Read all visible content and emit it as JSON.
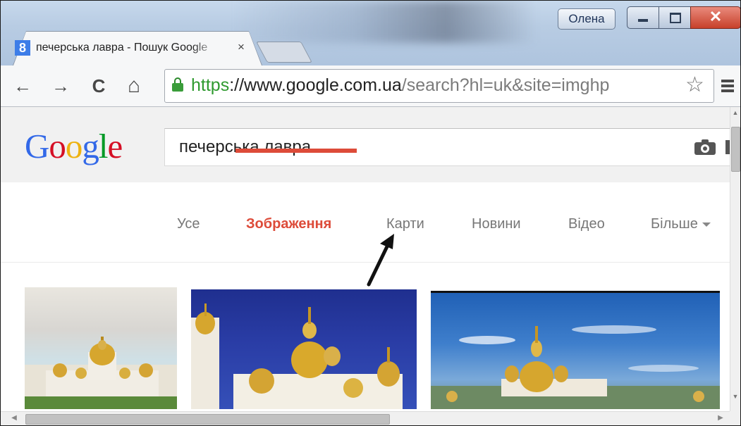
{
  "window": {
    "profile_name": "Олена"
  },
  "tab": {
    "favicon_letter": "8",
    "title": "печерська лавра - Пошук Google"
  },
  "toolbar": {
    "back_glyph": "←",
    "forward_glyph": "→",
    "reload_glyph": "C",
    "home_glyph": "⌂",
    "url_scheme": "https",
    "url_sep": "://",
    "url_host": "www.google.com.ua",
    "url_path": "/search?hl=uk&site=imghp",
    "star_glyph": "☆"
  },
  "google": {
    "logo_letters": [
      {
        "ch": "G",
        "color": "#3369e8"
      },
      {
        "ch": "o",
        "color": "#d50f25"
      },
      {
        "ch": "o",
        "color": "#eeb211"
      },
      {
        "ch": "g",
        "color": "#3369e8"
      },
      {
        "ch": "l",
        "color": "#009925"
      },
      {
        "ch": "e",
        "color": "#d50f25"
      }
    ],
    "query": "печерська лавра",
    "tabs": [
      {
        "label": "Усе",
        "active": false
      },
      {
        "label": "Зображення",
        "active": true
      },
      {
        "label": "Карти",
        "active": false
      },
      {
        "label": "Новини",
        "active": false
      },
      {
        "label": "Відео",
        "active": false
      },
      {
        "label": "Більше",
        "active": false
      }
    ]
  },
  "icons": {
    "camera": "camera-icon",
    "star": "star-icon",
    "menu": "menu-icon",
    "lock": "lock-icon"
  },
  "colors": {
    "active_tab": "#dd4b39",
    "secure_green": "#2f9a2f"
  }
}
